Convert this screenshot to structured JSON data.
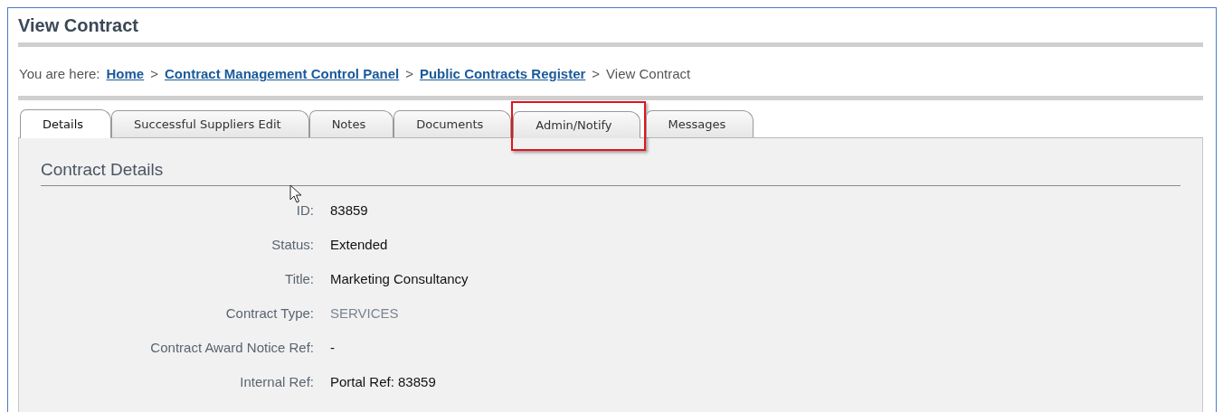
{
  "page": {
    "title": "View Contract"
  },
  "breadcrumb": {
    "prefix": "You are here:",
    "links": [
      {
        "label": "Home",
        "separator": ">"
      },
      {
        "label": "Contract Management Control Panel",
        "separator": ">"
      },
      {
        "label": "Public Contracts Register",
        "separator": ">"
      }
    ],
    "current": "View Contract"
  },
  "tabs": [
    {
      "label": "Details",
      "selected": true,
      "highlighted": false
    },
    {
      "label": "Successful Suppliers Edit",
      "selected": false,
      "highlighted": false
    },
    {
      "label": "Notes",
      "selected": false,
      "highlighted": false
    },
    {
      "label": "Documents",
      "selected": false,
      "highlighted": false
    },
    {
      "label": "Admin/Notify",
      "selected": false,
      "highlighted": true
    },
    {
      "label": "Messages",
      "selected": false,
      "highlighted": false
    }
  ],
  "section": {
    "heading": "Contract Details",
    "fields": [
      {
        "label": "ID:",
        "value": "83859",
        "muted": false
      },
      {
        "label": "Status:",
        "value": "Extended",
        "muted": false
      },
      {
        "label": "Title:",
        "value": "Marketing Consultancy",
        "muted": false
      },
      {
        "label": "Contract Type:",
        "value": "SERVICES",
        "muted": true
      },
      {
        "label": "Contract Award Notice Ref:",
        "value": "-",
        "muted": false
      },
      {
        "label": "Internal Ref:",
        "value": "Portal Ref: 83859",
        "muted": false
      }
    ]
  }
}
